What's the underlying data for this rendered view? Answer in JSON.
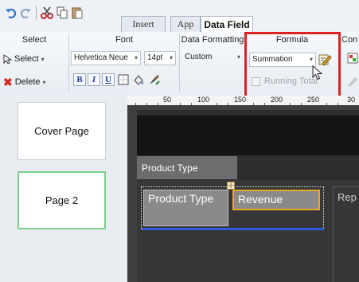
{
  "toolbar": {
    "undo_icon": "undo-icon",
    "redo_icon": "redo-icon",
    "cut_icon": "scissors-icon",
    "copy_icon": "copy-icon",
    "paste_icon": "paste-icon"
  },
  "tabs": [
    {
      "label": "Insert"
    },
    {
      "label": "App"
    },
    {
      "label": "Data Field"
    }
  ],
  "ribbon": {
    "groups": [
      {
        "title": "Select"
      },
      {
        "title": "Font"
      },
      {
        "title": "Data Formatting"
      },
      {
        "title": "Formula"
      },
      {
        "title": "Con"
      }
    ],
    "select_label": "Select",
    "delete_label": "Delete",
    "font_family": "Helvetica Neue",
    "font_size": "14pt",
    "bold_label": "B",
    "italic_label": "I",
    "underline_label": "U",
    "data_format": "Custom",
    "formula": "Summation",
    "running_total_label": "Running Total"
  },
  "ruler": {
    "labels": [
      "50",
      "100",
      "150",
      "200",
      "250",
      "30"
    ]
  },
  "pages": [
    {
      "label": "Cover Page"
    },
    {
      "label": "Page 2"
    }
  ],
  "canvas": {
    "group_header": "Product Type",
    "col1": "Product Type",
    "col2": "Revenue",
    "col3": "Rep"
  },
  "colors": {
    "highlight_red": "#e02020",
    "selected_page_border": "#7ccf8a",
    "revenue_border": "#e8a825",
    "underline_blue": "#2e5bd8"
  }
}
